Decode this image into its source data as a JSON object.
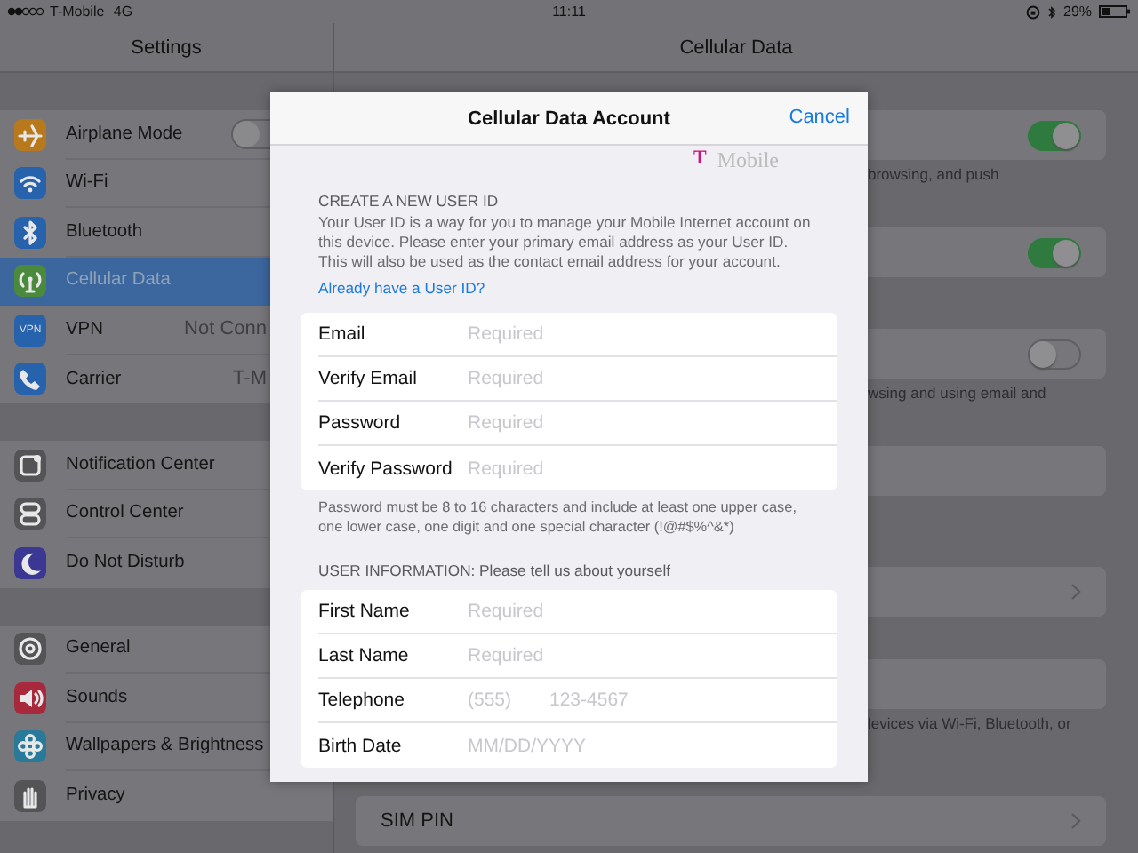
{
  "status_bar": {
    "carrier": "T-Mobile",
    "network": "4G",
    "time": "11:11",
    "battery": "29%"
  },
  "master": {
    "title": "Settings",
    "groups": [
      {
        "items": [
          {
            "label": "Airplane Mode",
            "color": "#b8791d",
            "kind": "toggle",
            "on": false,
            "selected": false
          },
          {
            "label": "Wi-Fi",
            "color": "#2762ad",
            "kind": "plain",
            "selected": false
          },
          {
            "label": "Bluetooth",
            "color": "#2762ad",
            "kind": "plain",
            "selected": false
          },
          {
            "label": "Cellular Data",
            "color": "#4b8a3c",
            "kind": "plain",
            "selected": true
          },
          {
            "label": "VPN",
            "color": "#2762ad",
            "kind": "value",
            "value": "Not Conn",
            "icon_text": "VPN",
            "selected": false
          },
          {
            "label": "Carrier",
            "color": "#2762ad",
            "kind": "value",
            "value": "T-M",
            "selected": false
          }
        ]
      },
      {
        "items": [
          {
            "label": "Notification Center",
            "color": "#545457",
            "kind": "plain",
            "selected": false
          },
          {
            "label": "Control Center",
            "color": "#545457",
            "kind": "plain",
            "selected": false
          },
          {
            "label": "Do Not Disturb",
            "color": "#3a3892",
            "kind": "plain",
            "selected": false
          }
        ]
      },
      {
        "items": [
          {
            "label": "General",
            "color": "#545457",
            "kind": "plain",
            "selected": false
          },
          {
            "label": "Sounds",
            "color": "#a8283c",
            "kind": "plain",
            "selected": false
          },
          {
            "label": "Wallpapers & Brightness",
            "color": "#28799a",
            "kind": "plain",
            "selected": false
          },
          {
            "label": "Privacy",
            "color": "#545457",
            "kind": "plain",
            "selected": false
          }
        ]
      }
    ]
  },
  "detail": {
    "title": "Cellular Data",
    "sections": [
      {
        "rows": [
          {
            "kind": "toggle",
            "on": true
          }
        ],
        "footer": "browsing, and push"
      },
      {
        "rows": [
          {
            "kind": "toggle",
            "on": true
          }
        ]
      },
      {
        "rows": [
          {
            "kind": "toggle",
            "on": false
          }
        ],
        "footer": "wsing and using email and"
      },
      {
        "rows": [
          {
            "kind": "blank"
          }
        ]
      },
      {
        "rows": [
          {
            "kind": "chevron"
          }
        ]
      },
      {
        "rows": [
          {
            "kind": "blank"
          }
        ],
        "footer": "levices via Wi-Fi, Bluetooth, or"
      },
      {
        "rows": [
          {
            "kind": "chevron",
            "label": "SIM PIN"
          }
        ]
      }
    ]
  },
  "sheet": {
    "title": "Cellular Data Account",
    "cancel": "Cancel",
    "logo": {
      "mark": "T",
      "text": "Mobile"
    },
    "sections": [
      {
        "header": "CREATE A NEW USER ID",
        "description": "Your User ID is a way for you to manage your Mobile Internet account on this device. Please enter your primary email address as your User ID. This will also be used as the contact email address for your account.",
        "link": "Already have a User ID?",
        "fields": [
          {
            "label": "Email",
            "placeholders": [
              "Required"
            ]
          },
          {
            "label": "Verify Email",
            "placeholders": [
              "Required"
            ]
          },
          {
            "label": "Password",
            "placeholders": [
              "Required"
            ]
          },
          {
            "label": "Verify Password",
            "placeholders": [
              "Required"
            ]
          }
        ],
        "footer": "Password must be 8 to 16 characters and include at least one upper case, one lower case, one digit and one special character (!@#$%^&*)"
      },
      {
        "header": "USER INFORMATION: Please tell us about yourself",
        "fields": [
          {
            "label": "First Name",
            "placeholders": [
              "Required"
            ]
          },
          {
            "label": "Last Name",
            "placeholders": [
              "Required"
            ]
          },
          {
            "label": "Telephone",
            "placeholders": [
              "(555)",
              "123-4567"
            ]
          },
          {
            "label": "Birth Date",
            "placeholders": [
              "MM/DD/YYYY"
            ]
          }
        ]
      }
    ]
  }
}
